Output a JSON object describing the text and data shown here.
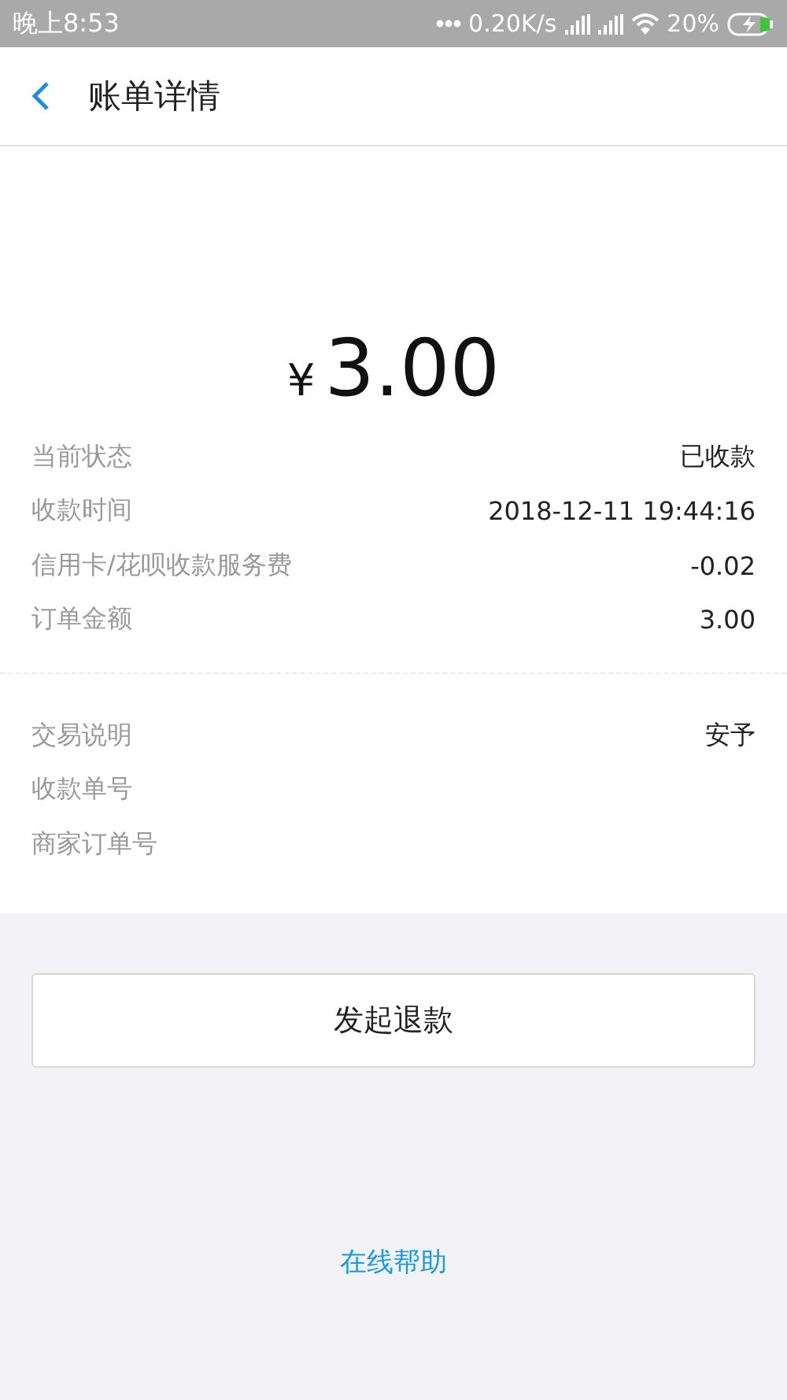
{
  "status_bar": {
    "time": "晚上8:53",
    "speed": "0.20K/s",
    "battery": "20%"
  },
  "header": {
    "title": "账单详情"
  },
  "amount": {
    "currency": "¥",
    "value": "3.00"
  },
  "sections": [
    {
      "rows": [
        {
          "label": "当前状态",
          "value": "已收款"
        },
        {
          "label": "收款时间",
          "value": "2018-12-11 19:44:16"
        },
        {
          "label": "信用卡/花呗收款服务费",
          "value": "-0.02"
        },
        {
          "label": "订单金额",
          "value": "3.00"
        }
      ]
    },
    {
      "rows": [
        {
          "label": "交易说明",
          "value": "安予"
        },
        {
          "label": "收款单号"
        },
        {
          "label": "商家订单号"
        }
      ]
    }
  ],
  "refund_button": "发起退款",
  "help_link": "在线帮助"
}
